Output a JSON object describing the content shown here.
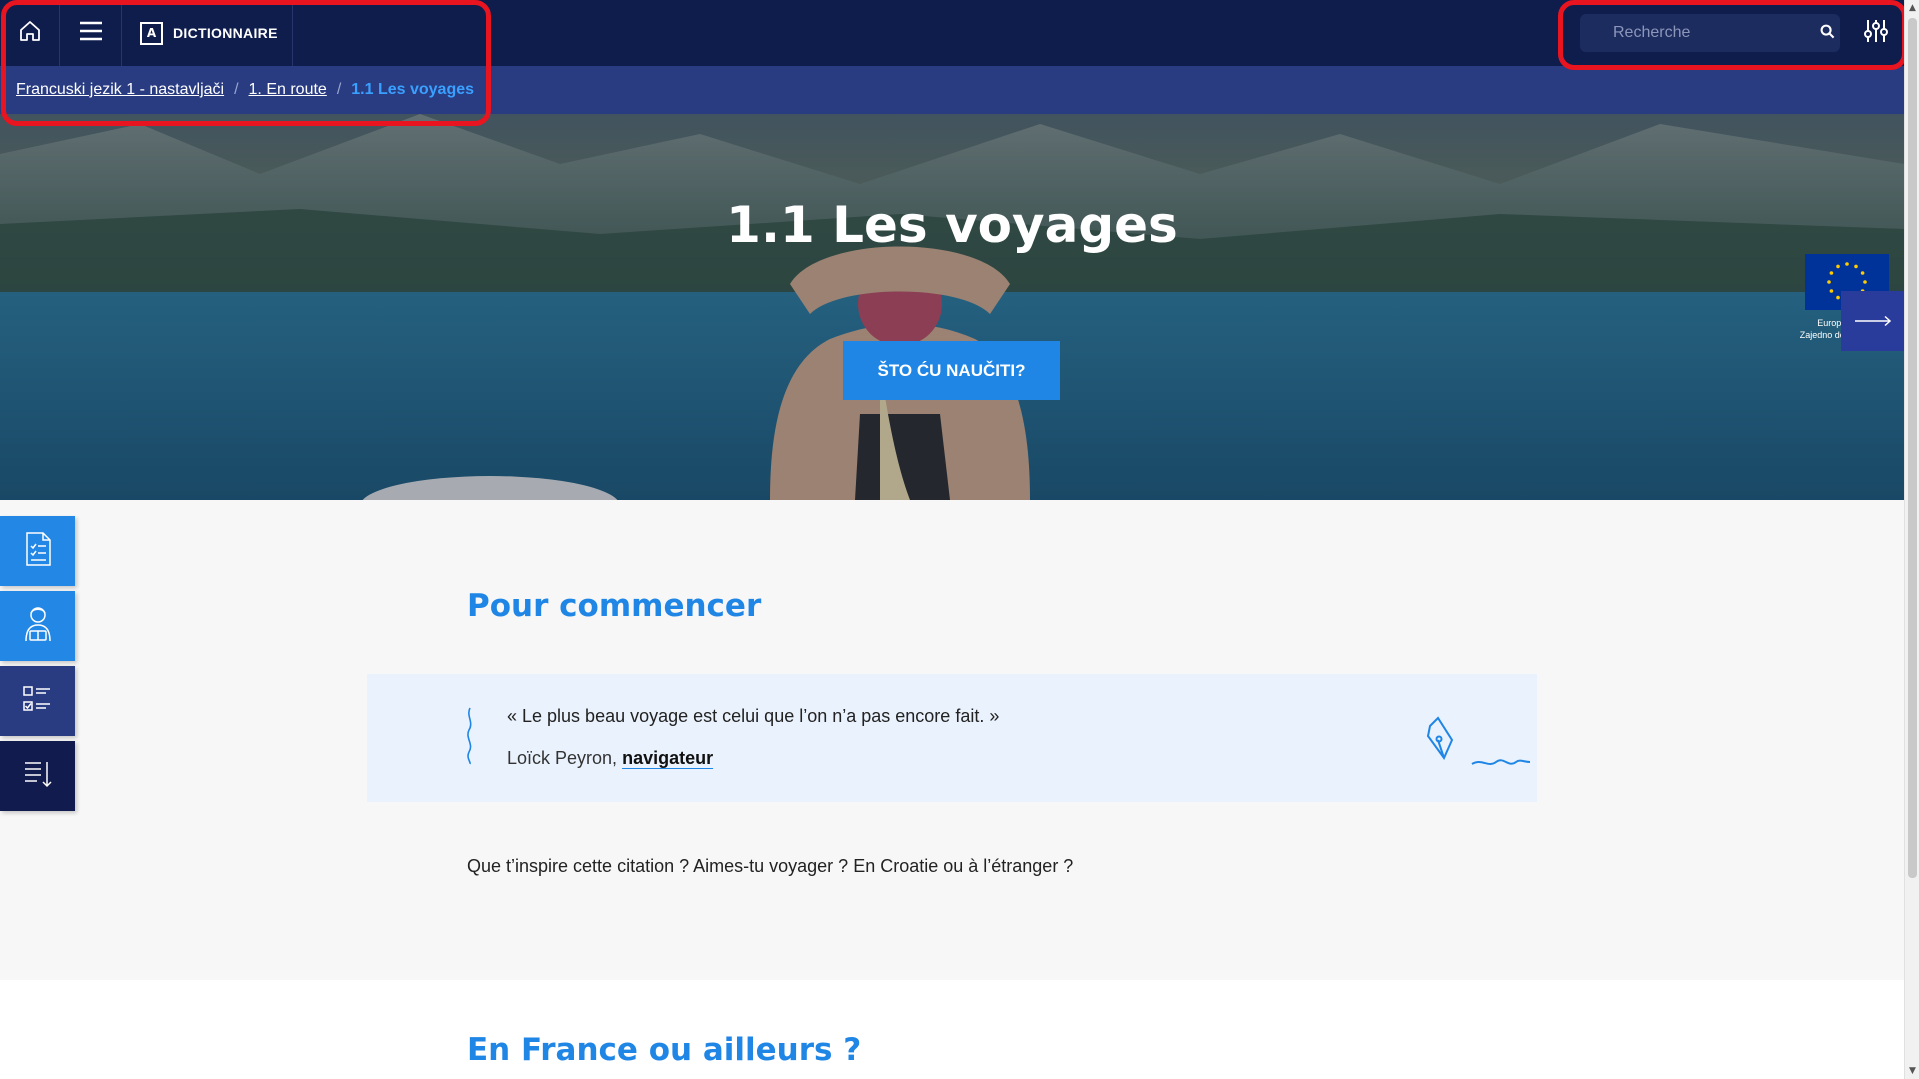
{
  "topbar": {
    "home_icon": "home-icon",
    "menu_icon": "hamburger-menu-icon",
    "dictionary": {
      "badge": "A",
      "label": "DICTIONNAIRE"
    },
    "search": {
      "placeholder": "Recherche",
      "value": ""
    },
    "settings_icon": "sliders-icon"
  },
  "breadcrumb": {
    "items": [
      "Francuski jezik 1 - nastavljači",
      "1. En route"
    ],
    "current": "1.1 Les voyages",
    "separator": "/"
  },
  "hero": {
    "title": "1.1 Les voyages",
    "button_label": "ŠTO ĆU NAUČITI?",
    "eu_line1": "Europska unija",
    "eu_line2": "Zajedno do fondova EU"
  },
  "side_tools": [
    {
      "icon": "checklist-document-icon"
    },
    {
      "icon": "student-person-icon"
    },
    {
      "icon": "task-list-icon"
    },
    {
      "icon": "sorted-list-icon"
    }
  ],
  "section1": {
    "heading": "Pour commencer",
    "quote": "« Le plus beau voyage est celui que l’on n’a pas encore fait. »",
    "author_name": "Loïck Peyron,",
    "author_link": "navigateur",
    "question": "Que t’inspire cette citation ? Aimes-tu voyager ? En Croatie ou à l’étranger ?"
  },
  "section2": {
    "heading": "En France ou ailleurs ?"
  },
  "colors": {
    "topbar": "#0f1d4d",
    "breadcrumb_bar": "#293c82",
    "accent_blue": "#1f86e6",
    "highlight_red": "#e8141f"
  }
}
